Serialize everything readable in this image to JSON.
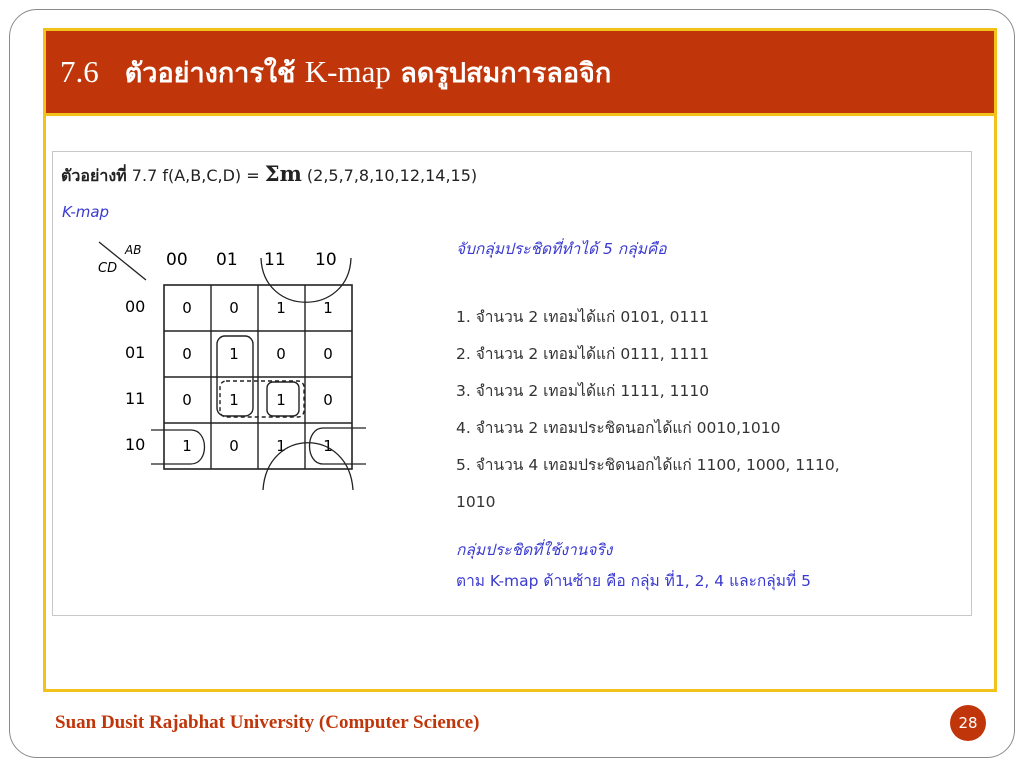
{
  "slide": {
    "number": "7.6",
    "title_a": "ตัวอย่างการใช้",
    "title_k": "K-map",
    "title_b": "ลดรูปสมการลอจิก"
  },
  "example": {
    "label": "ตัวอย่างที่",
    "number": "7.7",
    "function": "f(A,B,C,D) =",
    "sigma": "Σm",
    "minterms": "(2,5,7,8,10,12,14,15)",
    "kmap_label": "K-map"
  },
  "kmap": {
    "ab_label": "AB",
    "cd_label": "CD",
    "columns": [
      "00",
      "01",
      "11",
      "10"
    ],
    "rows": [
      "00",
      "01",
      "11",
      "10"
    ],
    "cells": [
      [
        "0",
        "0",
        "1",
        "1"
      ],
      [
        "0",
        "1",
        "0",
        "0"
      ],
      [
        "0",
        "1",
        "1",
        "0"
      ],
      [
        "1",
        "0",
        "1",
        "1"
      ]
    ]
  },
  "groups": {
    "heading": "จับกลุ่มประชิดที่ทำได้  5 กลุ่มคือ",
    "items": [
      "1. จำนวน 2 เทอมได้แก่  0101,  0111",
      "2. จำนวน 2 เทอมได้แก่  0111,  1111",
      "3. จำนวน 2 เทอมได้แก่  1111,  1110",
      "4. จำนวน 2 เทอมประชิดนอกได้แก่   0010,1010",
      "5. จำนวน 4 เทอมประชิดนอกได้แก่   1100,  1000,  1110,",
      "1010"
    ],
    "actual_heading": "กลุ่มประชิดที่ใช้งานจริง",
    "actual_text": "ตาม K-map ด้านซ้าย  คือ  กลุ่ม  ที่1, 2, 4  และกลุ่มที่  5"
  },
  "footer": {
    "institution": "Suan Dusit Rajabhat University (Computer Science)",
    "page": "28"
  },
  "colors": {
    "title_bg": "#c0360a",
    "accent_border": "#f2c21a",
    "blue_text": "#3a3ad0"
  }
}
